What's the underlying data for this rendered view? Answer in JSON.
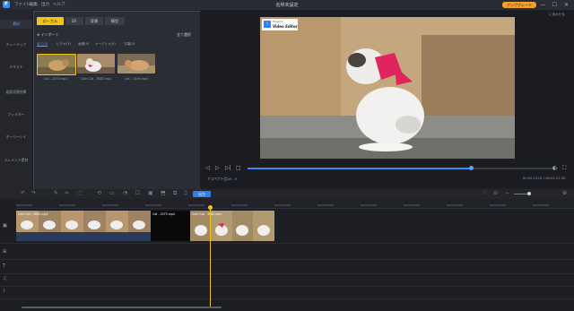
{
  "app": {
    "logo_letter": "F",
    "title": "名称未設定",
    "menu": [
      "ファイル",
      "編集",
      "出力",
      "ヘルプ"
    ],
    "upgrade_label": "アップグレード",
    "window_buttons": [
      "—",
      "☐",
      "✕"
    ]
  },
  "sidebar": {
    "items": [
      {
        "label": "素材",
        "active": true
      },
      {
        "label": "ミュージック",
        "active": false
      },
      {
        "label": "テキスト",
        "active": false
      },
      {
        "label": "画面切替効果",
        "active": false
      },
      {
        "label": "フィルター",
        "active": false
      },
      {
        "label": "オーバーレイ",
        "active": false
      },
      {
        "label": "エレメント素材",
        "active": false
      }
    ]
  },
  "media": {
    "tabs": [
      "ローカル",
      "DF",
      "背景",
      "模型"
    ],
    "import_label": "インポート",
    "select_all_label": "全て選択",
    "subtabs": [
      "全て(3)",
      "ビデオ(3)",
      "画像(0)",
      "オーディオ(0)",
      "字幕(0)"
    ],
    "thumbnails": [
      {
        "caption": "Cat - 2075.mp4"
      },
      {
        "caption": "Cute Cat - 3682.mp4"
      },
      {
        "caption": "Cat - 1449.mp4"
      }
    ]
  },
  "preview": {
    "watermark_brand": "EaseUS",
    "watermark_product": "Video Editor",
    "fit_label": "に合わせる",
    "aspect_label": "アスペクト比",
    "aspect_value": "16 : 9",
    "current_time": "00:00:14.01",
    "total_time": "00:01:12.33",
    "progress": 0.72,
    "controls": [
      "◁",
      "▷",
      "▷|",
      "□"
    ]
  },
  "toolbar": {
    "export_label": "出力",
    "tools": [
      "↶",
      "↷",
      "✎",
      "✂",
      "⬚",
      "⟲",
      "▭",
      "◔",
      "☐",
      "▣",
      "⬒",
      "⧉",
      "♫"
    ]
  },
  "timeline": {
    "ruler": [
      "00:00:00:00",
      "00:00:04:00",
      "00:00:08:00",
      "00:00:12:00",
      "00:00:16:00",
      "00:00:20:00",
      "00:00:24:00",
      "00:00:28:00",
      "00:00:32:00",
      "00:00:36:00",
      "00:00:40:00",
      "00:00:44:00",
      "00:00:48:00"
    ],
    "clips": [
      {
        "label": "Cute Cat - 3682.mp4"
      },
      {
        "label": "Cat - 2075.mp4"
      },
      {
        "label": "Cute Cat - 3682.mp4"
      }
    ],
    "track_icons": [
      "▣",
      "⊞",
      "T",
      "♫",
      "♪"
    ]
  },
  "colors": {
    "accent": "#3b8cf0",
    "tab_active": "#f0c419",
    "upgrade": "#f0a030"
  }
}
